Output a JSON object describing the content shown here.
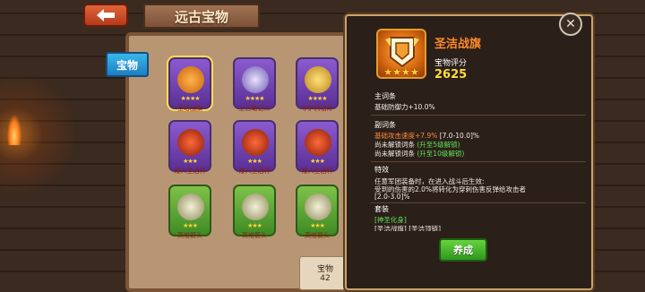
{
  "header": {
    "title": "远古宝物"
  },
  "tabs": [
    {
      "label": "宝物"
    }
  ],
  "grid": {
    "cards": [
      {
        "label": "圣洁战旗",
        "rarity": "purple",
        "selected": true,
        "stars": "★★★★"
      },
      {
        "label": "上古笔记二",
        "rarity": "purple",
        "selected": false,
        "stars": "★★★★"
      },
      {
        "label": "守护药油灯",
        "rarity": "purple",
        "selected": false,
        "stars": "★★★★"
      },
      {
        "label": "矮人圣酒杯",
        "rarity": "purple",
        "selected": false,
        "stars": "★★★"
      },
      {
        "label": "矮人圣酒杯",
        "rarity": "purple",
        "selected": false,
        "stars": "★★★"
      },
      {
        "label": "矮人圣酒杯",
        "rarity": "purple",
        "selected": false,
        "stars": "★★★"
      },
      {
        "label": "高维箭头",
        "rarity": "green",
        "selected": false,
        "stars": "★★★"
      },
      {
        "label": "高维箭头",
        "rarity": "green",
        "selected": false,
        "stars": "★★★"
      },
      {
        "label": "高维箭头",
        "rarity": "green",
        "selected": false,
        "stars": "★★★"
      }
    ],
    "count_label": "宝物",
    "count_value": "42"
  },
  "tooltip": {
    "name": "圣洁战旗",
    "stars": "★★★★",
    "rating_label": "宝物评分",
    "rating_value": "2625",
    "main_attr_head": "主词条",
    "main_attr": "基础防御力+10.0%",
    "sub_attr_head": "副词条",
    "sub_attr_1": "基础攻击速度+7.9%",
    "sub_attr_1_range": " [7.0-10.0]%",
    "sub_attr_2": "尚未解锁词条",
    "sub_attr_2_note": " (升至5级解锁)",
    "sub_attr_3": "尚未解锁词条",
    "sub_attr_3_note": " (升至10级解锁)",
    "effect_head": "特效",
    "effect_line_1": "任意军团装备时，在进入战斗后生效:",
    "effect_line_2": "受到的伤害的2.0%将转化为穿刺伤害反弹给攻击者",
    "effect_line_3": "[2.0-3.0]%",
    "set_head": "套装",
    "set_name": "[神圣化身]",
    "set_line": "[圣洁战旗] [圣洁顶链]",
    "equip_label": "养成",
    "close_symbol": "✕"
  },
  "colors": {
    "item_name": "#ff8a2a",
    "rating": "#ffde3a",
    "unlock_note": "#5fe35a",
    "equip_button": "#4fb82e",
    "tab": "#2a9ad8"
  }
}
